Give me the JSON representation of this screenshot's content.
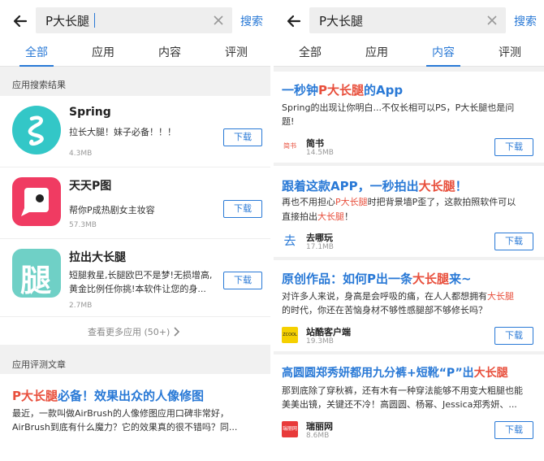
{
  "left": {
    "search": {
      "query": "P大长腿",
      "button": "搜索"
    },
    "tabs": [
      "全部",
      "应用",
      "内容",
      "评测"
    ],
    "apps_section_title": "应用搜索结果",
    "apps": [
      {
        "name": "Spring",
        "desc": "拉长大腿！妹子必备！！！",
        "size": "4.3MB",
        "download": "下载"
      },
      {
        "name": "天天P图",
        "desc": "帮你P成热剧女主妆容",
        "size": "57.3MB",
        "download": "下载"
      },
      {
        "name": "拉出大长腿",
        "desc_line1": "短腿救星,长腿欧巴不是梦!无损增高,",
        "desc_line2": "黄金比例任你挑!本软件让您的身...",
        "size": "2.7MB",
        "download": "下载",
        "icon_glyph": "腿"
      }
    ],
    "more_apps": "查看更多应用 (50+)",
    "reviews_section_title": "应用评测文章",
    "review": {
      "title_hl": "P大长腿",
      "title_rest": "必备！效果出众的人像修图",
      "line1": "最近，一款叫做AirBrush的人像修图应用口碑非常好，",
      "line2": "AirBrush到底有什么魔力？它的效果真的很不错吗？同..."
    }
  },
  "right": {
    "search": {
      "query": "P大长腿",
      "button": "搜索"
    },
    "tabs": [
      "全部",
      "应用",
      "内容",
      "评测"
    ],
    "articles": [
      {
        "title_a": "一秒钟",
        "title_hl": "P大长腿",
        "title_b": "的App",
        "line1": "Spring的出现让你明白...不仅长相可以PS，P大长腿也是问",
        "line2": "题!",
        "source": "简书",
        "icon_text": "简书",
        "size": "14.5MB",
        "download": "下载"
      },
      {
        "title_a": "跟着这款APP，一秒拍出",
        "title_hl": "大长腿",
        "title_b": "！",
        "line1_a": "再也不用担心",
        "line1_hl": "P大长腿",
        "line1_b": "时把背景墙P歪了，这款拍照软件可以",
        "line2_a": "直接拍出",
        "line2_hl": "大长腿",
        "line2_b": "！",
        "source": "去哪玩",
        "icon_text": "去",
        "size": "17.1MB",
        "download": "下载"
      },
      {
        "title_a": "原创作品：如何P出一条",
        "title_hl": "大长腿",
        "title_b": "来~",
        "line1_a": "对许多人来说，身高是会呼吸的痛，在人人都想拥有",
        "line1_hl": "大长腿",
        "line2": "的时代，你还在苦恼身材不够性感腿部不够修长吗？",
        "source": "站酷客户端",
        "icon_text": "ZCOOL",
        "size": "19.3MB",
        "download": "下载"
      },
      {
        "title_a": "高圆圆郑秀妍都用九分裤+短靴“P”出",
        "title_hl": "大长腿",
        "title_b": "",
        "line1": "那到底除了穿秋裤，还有木有一种穿法能够不用变大粗腿也能",
        "line2": "美美出镜，关键还不冷！高圆圆、杨幂、Jessica郑秀妍、...",
        "source": "瑞丽网",
        "icon_text": "瑞丽网",
        "size": "8.6MB",
        "download": "下载"
      }
    ]
  },
  "colors": {
    "accent": "#2979d6",
    "highlight": "#e84f3c",
    "background": "#f1f1f1"
  }
}
